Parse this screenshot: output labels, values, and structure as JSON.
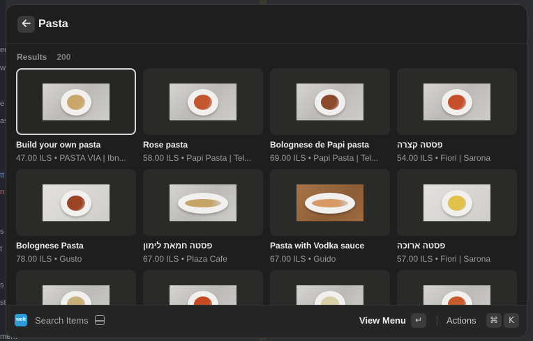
{
  "background": {
    "left_fragments": [
      "er",
      "w",
      "e",
      "as",
      "tt",
      "n",
      "s",
      "t",
      "s",
      "st"
    ],
    "bottom_text": "ment"
  },
  "search": {
    "back_icon": "arrow-left",
    "query": "Pasta"
  },
  "results": {
    "label": "Results",
    "count": "200"
  },
  "items": [
    {
      "title": "Build your own pasta",
      "subtitle": "47.00 ILS • PASTA VIA | Ibn...",
      "food_color": "#c9a76a",
      "selected": true
    },
    {
      "title": "Rose pasta",
      "subtitle": "58.00 ILS • Papi Pasta | Tel...",
      "food_color": "#c2562e"
    },
    {
      "title": "Bolognese de Papi pasta",
      "subtitle": "69.00 ILS • Papi Pasta | Tel...",
      "food_color": "#8c4a2c"
    },
    {
      "title": "פסטה קצרה",
      "subtitle": "54.00 ILS • Fiori | Sarona",
      "food_color": "#c6502a"
    },
    {
      "title": "Bolognese Pasta",
      "subtitle": "78.00 ILS • Gusto",
      "food_color": "#9a4526"
    },
    {
      "title": "פסטה חמאת לימון",
      "subtitle": "67.00 ILS • Plaza Cafe",
      "food_color": "#c7a46a"
    },
    {
      "title": "Pasta with Vodka sauce",
      "subtitle": "67.00 ILS • Guido",
      "food_color": "#d79a66"
    },
    {
      "title": "פסטה ארוכה",
      "subtitle": "57.00 ILS • Fiori | Sarona",
      "food_color": "#e0c24a"
    },
    {
      "title": "",
      "subtitle": "",
      "food_color": "#c9b07a"
    },
    {
      "title": "",
      "subtitle": "",
      "food_color": "#c44a22"
    },
    {
      "title": "",
      "subtitle": "",
      "food_color": "#d8cfa6"
    },
    {
      "title": "",
      "subtitle": "",
      "food_color": "#c85a2e"
    }
  ],
  "footer": {
    "app_icon": "app-logo",
    "search_items_label": "Search Items",
    "primary_action": "View Menu",
    "enter_key": "↵",
    "actions_label": "Actions",
    "cmd_key": "⌘",
    "k_key": "K"
  }
}
